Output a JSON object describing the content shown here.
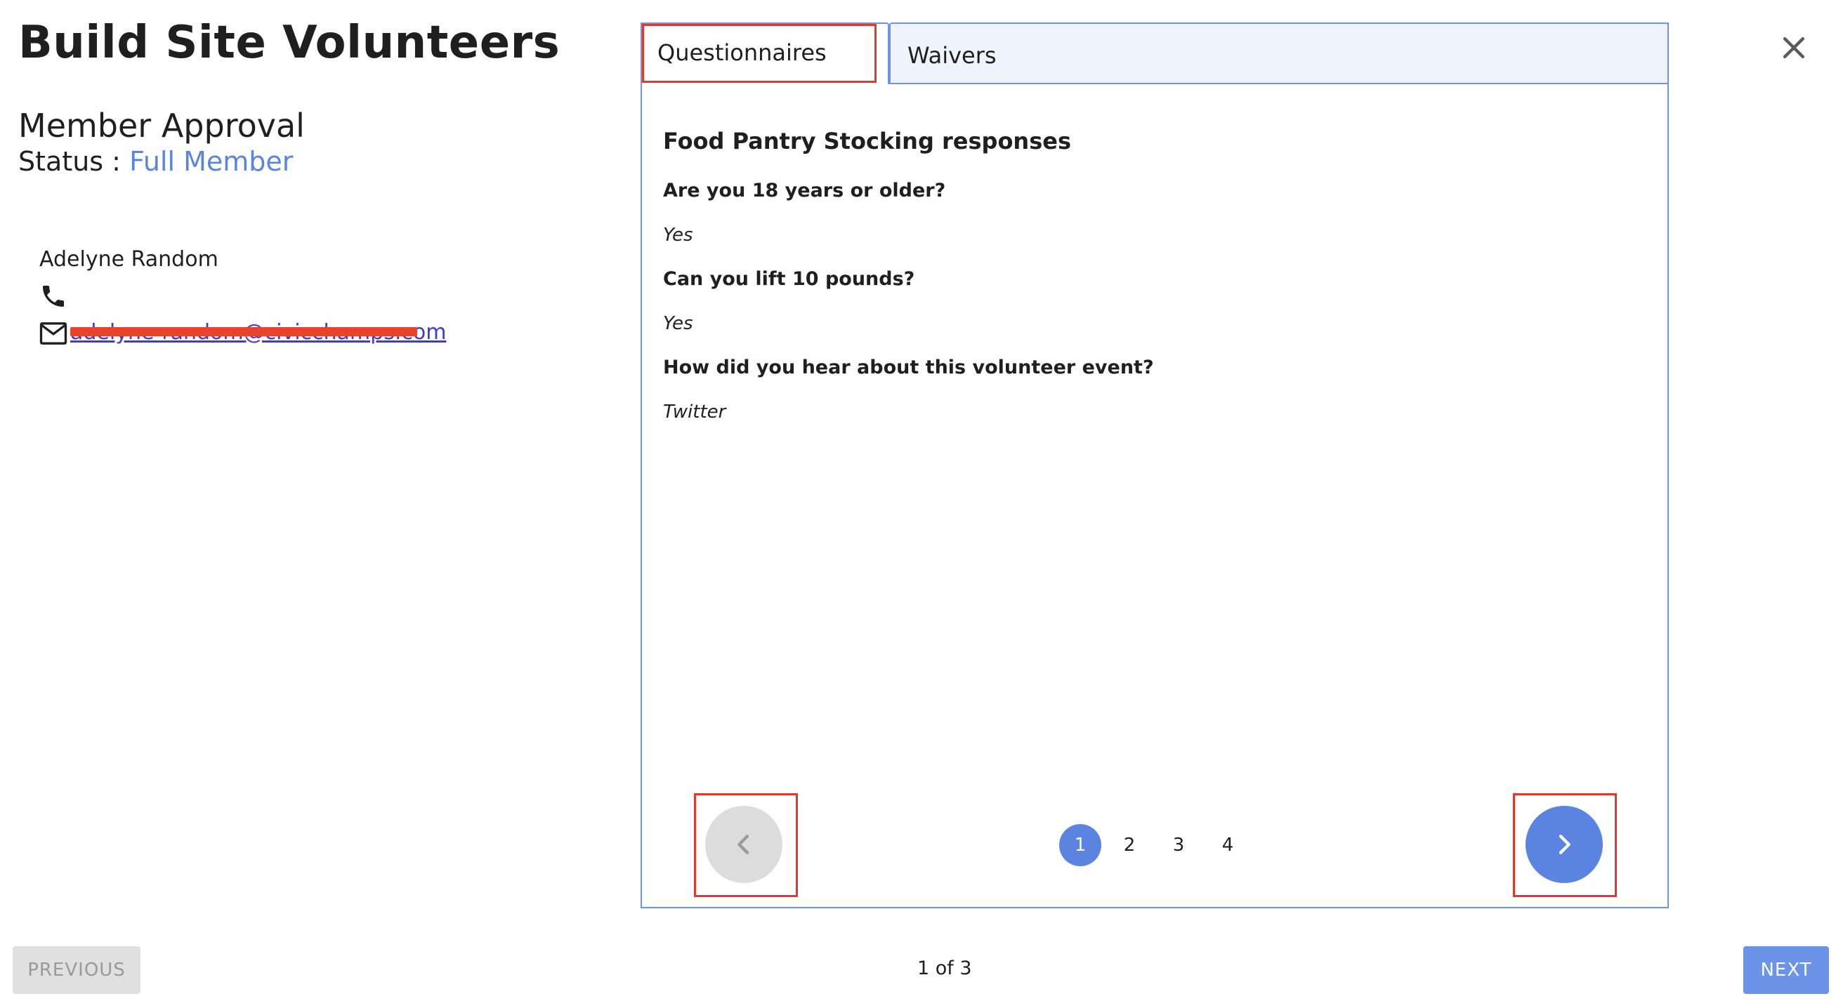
{
  "header": {
    "title": "Build Site Volunteers"
  },
  "approval": {
    "section_title": "Member Approval",
    "status_label": "Status : ",
    "status_value": "Full Member",
    "status_color": "#5b84e0"
  },
  "member": {
    "name": "Adelyne Random",
    "phone_icon": "phone-icon",
    "mail_icon": "mail-icon",
    "email": "adelyne-random@civicchamps.com",
    "email_redacted": true
  },
  "tabs": [
    {
      "label": "Questionnaires",
      "active": true
    },
    {
      "label": "Waivers",
      "active": false
    }
  ],
  "questionnaire": {
    "title": "Food Pantry Stocking responses",
    "items": [
      {
        "question": "Are you 18 years or older?",
        "answer": "Yes"
      },
      {
        "question": "Can you lift 10 pounds?",
        "answer": "Yes"
      },
      {
        "question": "How did you hear about this volunteer event?",
        "answer": "Twitter"
      }
    ]
  },
  "pagination": {
    "pages": [
      "1",
      "2",
      "3",
      "4"
    ],
    "current": "1",
    "prev_icon": "chevron-left-icon",
    "next_icon": "chevron-right-icon"
  },
  "footer": {
    "previous_label": "PREVIOUS",
    "step_text": "1 of 3",
    "next_label": "NEXT"
  },
  "colors": {
    "accent": "#5b84e0",
    "highlight": "#e23a2a",
    "panel_border": "#6b93e8",
    "inactive_tab_bg": "#eef3fc"
  }
}
